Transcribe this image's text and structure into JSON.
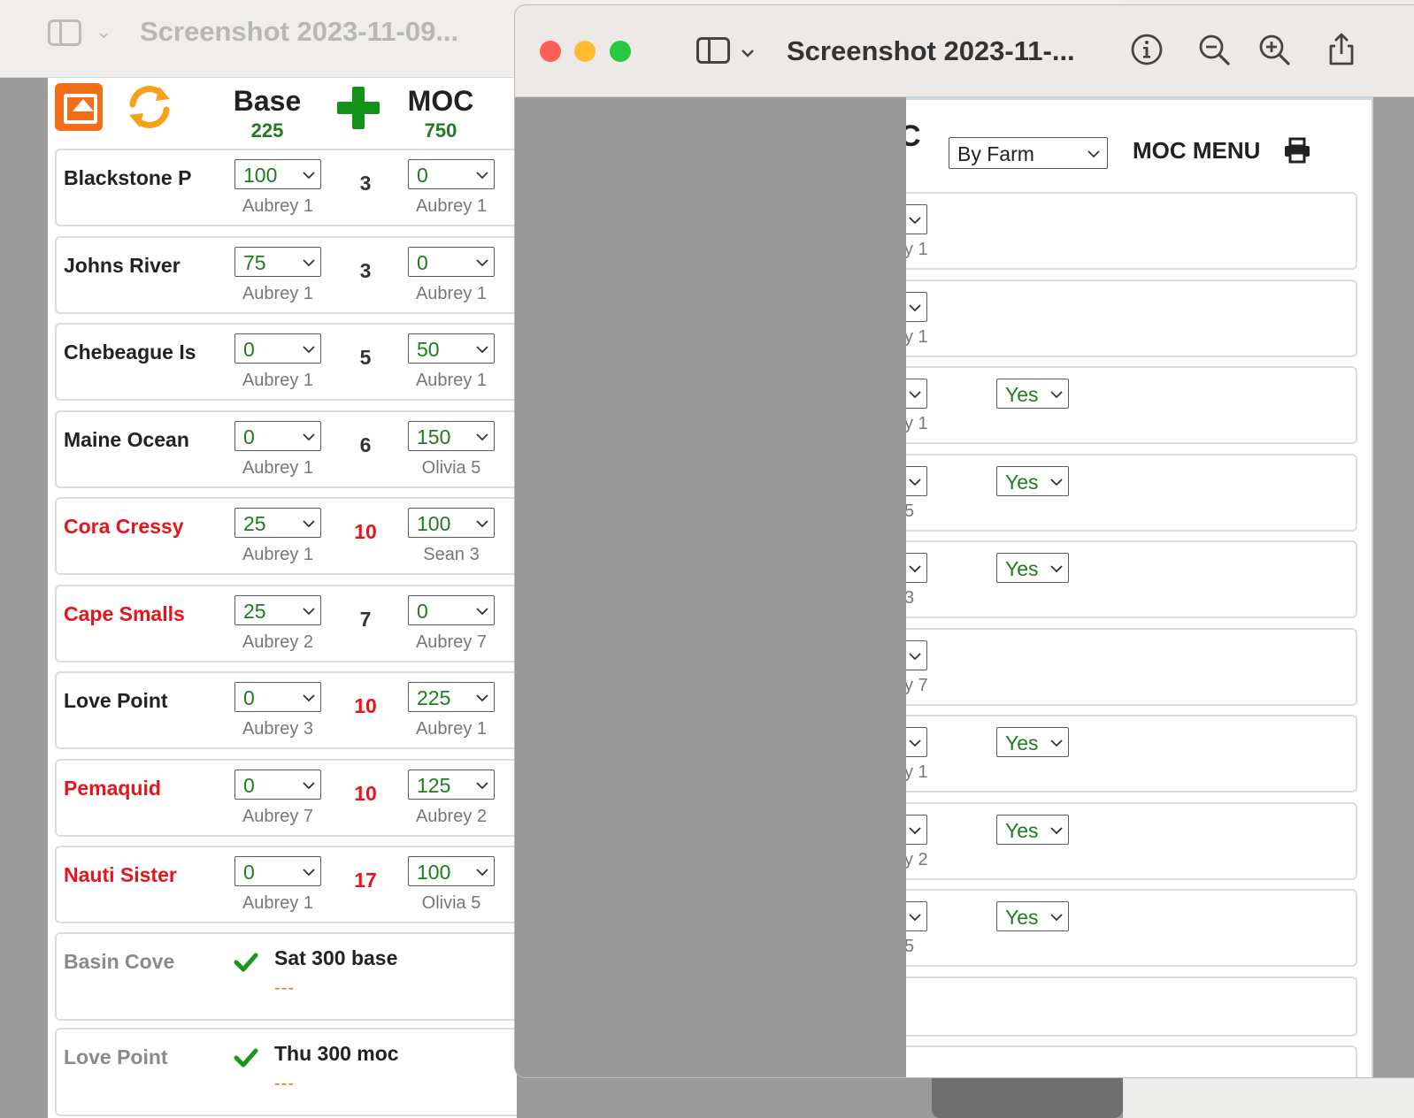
{
  "back_window": {
    "title": "Screenshot 2023-11-09..."
  },
  "app": {
    "header": {
      "base_label": "Base",
      "base_total": "225",
      "moc_label": "MOC",
      "moc_total": "750"
    },
    "rows": [
      {
        "farm": "Blackstone P",
        "status": "normal",
        "base_value": "100",
        "base_who": "Aubrey 1",
        "days": "3",
        "days_status": "normal",
        "moc_value": "0",
        "moc_who": "Aubrey 1"
      },
      {
        "farm": "Johns River",
        "status": "normal",
        "base_value": "75",
        "base_who": "Aubrey 1",
        "days": "3",
        "days_status": "normal",
        "moc_value": "0",
        "moc_who": "Aubrey 1"
      },
      {
        "farm": "Chebeague Is",
        "status": "normal",
        "base_value": "0",
        "base_who": "Aubrey 1",
        "days": "5",
        "days_status": "normal",
        "moc_value": "50",
        "moc_who": "Aubrey 1"
      },
      {
        "farm": "Maine Ocean",
        "status": "normal",
        "base_value": "0",
        "base_who": "Aubrey 1",
        "days": "6",
        "days_status": "normal",
        "moc_value": "150",
        "moc_who": "Olivia 5"
      },
      {
        "farm": "Cora Cressy",
        "status": "alert",
        "base_value": "25",
        "base_who": "Aubrey 1",
        "days": "10",
        "days_status": "alert",
        "moc_value": "100",
        "moc_who": "Sean 3"
      },
      {
        "farm": "Cape Smalls",
        "status": "alert",
        "base_value": "25",
        "base_who": "Aubrey 2",
        "days": "7",
        "days_status": "normal",
        "moc_value": "0",
        "moc_who": "Aubrey 7"
      },
      {
        "farm": "Love Point",
        "status": "normal",
        "base_value": "0",
        "base_who": "Aubrey 3",
        "days": "10",
        "days_status": "alert",
        "moc_value": "225",
        "moc_who": "Aubrey 1"
      },
      {
        "farm": "Pemaquid",
        "status": "alert",
        "base_value": "0",
        "base_who": "Aubrey 7",
        "days": "10",
        "days_status": "alert",
        "moc_value": "125",
        "moc_who": "Aubrey 2"
      },
      {
        "farm": "Nauti Sister",
        "status": "alert",
        "base_value": "0",
        "base_who": "Aubrey 1",
        "days": "17",
        "days_status": "alert",
        "moc_value": "100",
        "moc_who": "Olivia 5"
      }
    ],
    "done_rows": [
      {
        "farm": "Basin Cove",
        "note": "Sat 300 base",
        "dash": "---"
      },
      {
        "farm": "Love Point",
        "note": "Thu 300 moc",
        "dash": "---"
      }
    ]
  },
  "front_window": {
    "title": "Screenshot 2023-11-...",
    "partial_heading": "C",
    "filter_value": "By Farm",
    "menu_label": "MOC MENU",
    "rows": [
      {
        "who_partial": "y 1",
        "yes": ""
      },
      {
        "who_partial": "y 1",
        "yes": ""
      },
      {
        "who_partial": "y 1",
        "yes": "Yes"
      },
      {
        "who_partial": "5",
        "yes": "Yes"
      },
      {
        "who_partial": "3",
        "yes": "Yes"
      },
      {
        "who_partial": "y 7",
        "yes": ""
      },
      {
        "who_partial": "y 1",
        "yes": "Yes"
      },
      {
        "who_partial": "y 2",
        "yes": "Yes"
      },
      {
        "who_partial": "5",
        "yes": "Yes"
      }
    ]
  },
  "colors": {
    "alert": "#e8141b",
    "value_green": "#1d7d1d",
    "accent_orange": "#f26f1a",
    "traffic_red": "#fe5f57",
    "traffic_yellow": "#febc2e",
    "traffic_green": "#28c840"
  }
}
